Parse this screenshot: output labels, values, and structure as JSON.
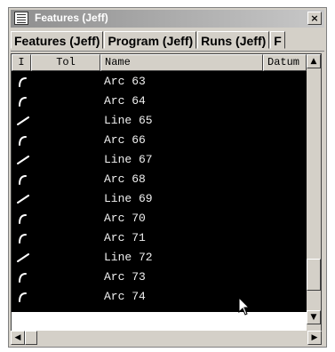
{
  "window": {
    "title": "Features (Jeff)",
    "close_glyph": "×",
    "icon": "list-window-icon"
  },
  "tabs": [
    {
      "label": "Features (Jeff)"
    },
    {
      "label": "Program (Jeff)"
    },
    {
      "label": "Runs (Jeff)"
    },
    {
      "label": "F"
    }
  ],
  "grid": {
    "columns": {
      "type": "I",
      "tol": "Tol",
      "name": "Name",
      "datum": "Datum"
    },
    "rows": [
      {
        "type": "arc",
        "name": "Arc 63"
      },
      {
        "type": "arc",
        "name": "Arc 64"
      },
      {
        "type": "line",
        "name": "Line 65"
      },
      {
        "type": "arc",
        "name": "Arc 66"
      },
      {
        "type": "line",
        "name": "Line 67"
      },
      {
        "type": "arc",
        "name": "Arc 68"
      },
      {
        "type": "line",
        "name": "Line 69"
      },
      {
        "type": "arc",
        "name": "Arc 70"
      },
      {
        "type": "arc",
        "name": "Arc 71"
      },
      {
        "type": "line",
        "name": "Line 72"
      },
      {
        "type": "arc",
        "name": "Arc 73"
      },
      {
        "type": "arc",
        "name": "Arc 74"
      }
    ]
  },
  "scrollbars": {
    "up": "▲",
    "down": "▼",
    "left": "◀",
    "right": "▶"
  },
  "colors": {
    "grid_bg": "#000000",
    "row_text": "#f0f0f0",
    "icon": "#ffffff",
    "chrome": "#d4d0c8"
  }
}
